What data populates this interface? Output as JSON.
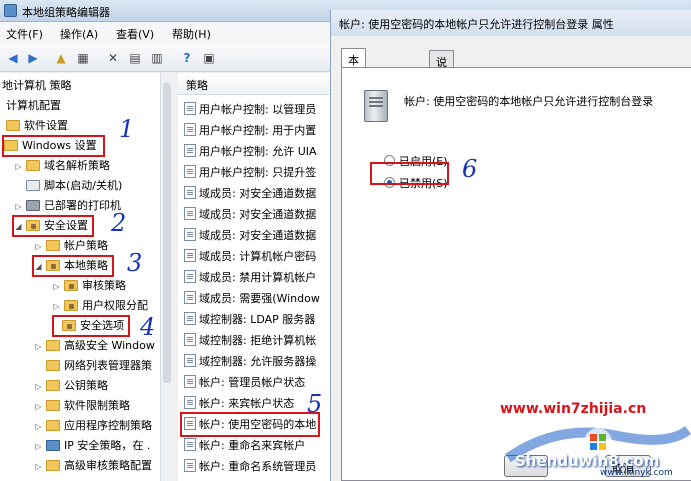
{
  "window": {
    "title": "本地组策略编辑器"
  },
  "menu": {
    "items": [
      "文件(F)",
      "操作(A)",
      "查看(V)",
      "帮助(H)"
    ]
  },
  "tree": {
    "items": [
      {
        "label": "地计算机 策略"
      },
      {
        "label": "计算机配置"
      },
      {
        "label": "软件设置"
      },
      {
        "label": "Windows 设置"
      },
      {
        "label": "域名解析策略"
      },
      {
        "label": "脚本(启动/关机)"
      },
      {
        "label": "已部署的打印机"
      },
      {
        "label": "安全设置"
      },
      {
        "label": "帐户策略"
      },
      {
        "label": "本地策略"
      },
      {
        "label": "审核策略"
      },
      {
        "label": "用户权限分配"
      },
      {
        "label": "安全选项"
      },
      {
        "label": "高级安全 Window"
      },
      {
        "label": "网络列表管理器策"
      },
      {
        "label": "公钥策略"
      },
      {
        "label": "软件限制策略"
      },
      {
        "label": "应用程序控制策略"
      },
      {
        "label": "IP 安全策略，在 ."
      },
      {
        "label": "高级审核策略配置"
      }
    ]
  },
  "policy": {
    "header": "策略",
    "rows": [
      "用户帐户控制: 以管理员",
      "用户帐户控制: 用于内置",
      "用户帐户控制: 允许 UIA",
      "用户帐户控制: 只提升签",
      "域成员: 对安全通道数据",
      "域成员: 对安全通道数据",
      "域成员: 对安全通道数据",
      "域成员: 计算机帐户密码",
      "域成员: 禁用计算机帐户",
      "域成员: 需要强(Window",
      "域控制器: LDAP 服务器",
      "域控制器: 拒绝计算机帐",
      "域控制器: 允许服务器操",
      "帐户: 管理员帐户状态",
      "帐户: 来宾帐户状态",
      "帐户: 使用空密码的本地",
      "帐户: 重命名来宾帐户",
      "帐户: 重命名系统管理员"
    ]
  },
  "dialog": {
    "title": "帐户: 使用空密码的本地帐户只允许进行控制台登录 属性",
    "tabs": [
      "本地安全设置",
      "说明"
    ],
    "description": "帐户: 使用空密码的本地帐户只允许进行控制台登录",
    "options": {
      "enabled": "已启用(E)",
      "disabled": "已禁用(S)"
    },
    "selected": "disabled",
    "buttons": {
      "cancel": "取消"
    }
  },
  "annotations": [
    "1",
    "2",
    "3",
    "4",
    "5",
    "6"
  ],
  "watermark": {
    "url": "www.win7zhijia.cn",
    "logo": "Shenduwin8.com",
    "sub": "www.lxinyk.com"
  }
}
